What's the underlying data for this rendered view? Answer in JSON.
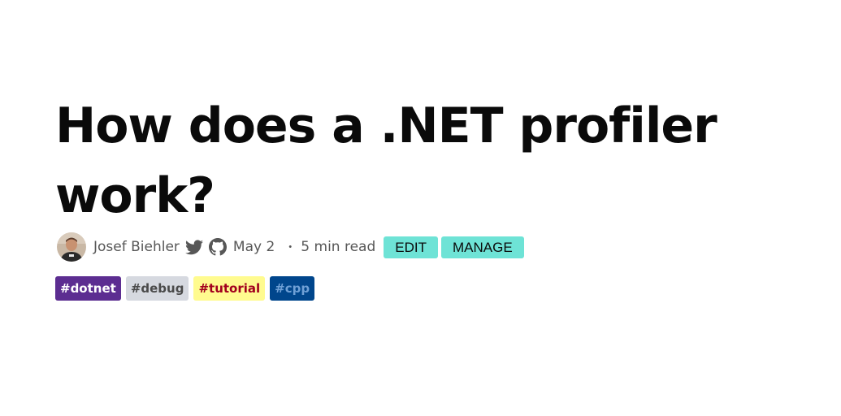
{
  "article": {
    "title": "How does a .NET profiler work?",
    "author": "Josef Biehler",
    "date": "May 2",
    "separator": "・",
    "read_time": "5 min read",
    "edit_label": "EDIT",
    "manage_label": "MANAGE"
  },
  "icons": {
    "avatar": "author-avatar",
    "twitter": "twitter-icon",
    "github": "github-icon"
  },
  "colors": {
    "meta_text": "#575757",
    "action_button_bg": "#6ee3d6"
  },
  "tags": [
    {
      "label": "#dotnet",
      "bg": "#5c2d91",
      "fg": "#ffffff"
    },
    {
      "label": "#debug",
      "bg": "#d6d9e0",
      "fg": "#4a4a4a"
    },
    {
      "label": "#tutorial",
      "bg": "#fffb8f",
      "fg": "#a2001d"
    },
    {
      "label": "#cpp",
      "bg": "#00468c",
      "fg": "#6fa0d6"
    }
  ]
}
